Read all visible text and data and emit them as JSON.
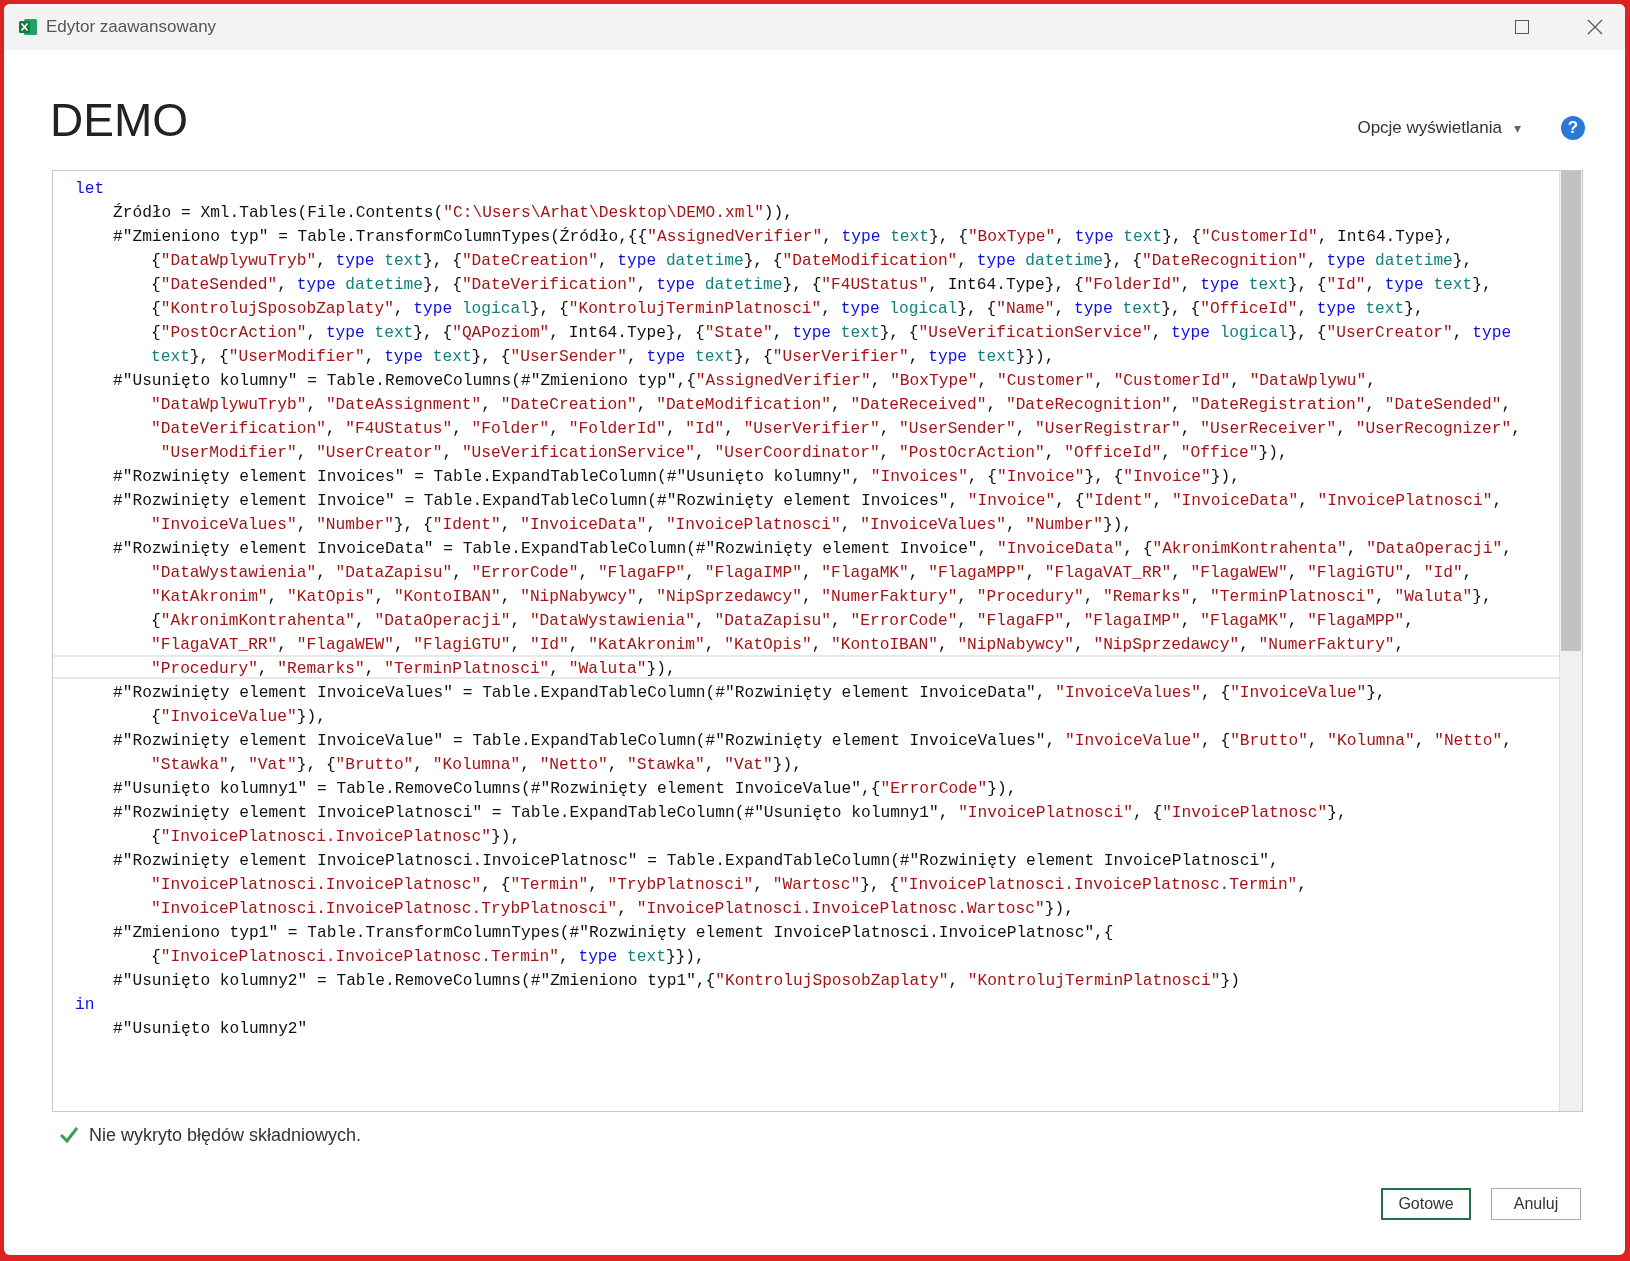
{
  "window": {
    "title": "Edytor zaawansowany"
  },
  "query_name": "DEMO",
  "display_options": {
    "label": "Opcje wyświetlania",
    "caret": "▾"
  },
  "help": {
    "label": "?"
  },
  "editor": {
    "lines": [
      {
        "kind": "keyword",
        "text": "let",
        "current": false,
        "children": [
          {
            "kind": "code",
            "text": "Źródło = Xml.Tables(File.Contents(\"C:\\Users\\Arhat\\Desktop\\DEMO.xml\")),",
            "current": false
          },
          {
            "kind": "code",
            "text": "#\"Zmieniono typ\" = Table.TransformColumnTypes(Źródło,{{\"AssignedVerifier\", type text}, {\"BoxType\", type text}, {\"CustomerId\", Int64.Type},",
            "current": false,
            "children": [
              {
                "kind": "code",
                "text": "{\"DataWplywuTryb\", type text}, {\"DateCreation\", type datetime}, {\"DateModification\", type datetime}, {\"DateRecognition\", type datetime},",
                "current": false
              },
              {
                "kind": "code",
                "text": "{\"DateSended\", type datetime}, {\"DateVerification\", type datetime}, {\"F4UStatus\", Int64.Type}, {\"FolderId\", type text}, {\"Id\", type text},",
                "current": false
              },
              {
                "kind": "code",
                "text": "{\"KontrolujSposobZaplaty\", type logical}, {\"KontrolujTerminPlatnosci\", type logical}, {\"Name\", type text}, {\"OfficeId\", type text},",
                "current": false
              },
              {
                "kind": "code",
                "text": "{\"PostOcrAction\", type text}, {\"QAPoziom\", Int64.Type}, {\"State\", type text}, {\"UseVerificationService\", type logical}, {\"UserCreator\", type",
                "current": false
              },
              {
                "kind": "code",
                "text": "text}, {\"UserModifier\", type text}, {\"UserSender\", type text}, {\"UserVerifier\", type text}}),",
                "current": false
              }
            ]
          },
          {
            "kind": "code",
            "text": "#\"Usunięto kolumny\" = Table.RemoveColumns(#\"Zmieniono typ\",{\"AssignedVerifier\", \"BoxType\", \"Customer\", \"CustomerId\", \"DataWplywu\",",
            "current": false,
            "children": [
              {
                "kind": "code",
                "text": "\"DataWplywuTryb\", \"DateAssignment\", \"DateCreation\", \"DateModification\", \"DateReceived\", \"DateRecognition\", \"DateRegistration\", \"DateSended\",",
                "current": false
              },
              {
                "kind": "code",
                "text": "\"DateVerification\", \"F4UStatus\", \"Folder\", \"FolderId\", \"Id\", \"UserVerifier\", \"UserSender\", \"UserRegistrar\", \"UserReceiver\", \"UserRecognizer\",",
                "current": false
              },
              {
                "kind": "code",
                "text": " \"UserModifier\", \"UserCreator\", \"UseVerificationService\", \"UserCoordinator\", \"PostOcrAction\", \"OfficeId\", \"Office\"}),",
                "current": false
              }
            ]
          },
          {
            "kind": "code",
            "text": "#\"Rozwinięty element Invoices\" = Table.ExpandTableColumn(#\"Usunięto kolumny\", \"Invoices\", {\"Invoice\"}, {\"Invoice\"}),",
            "current": false
          },
          {
            "kind": "code",
            "text": "#\"Rozwinięty element Invoice\" = Table.ExpandTableColumn(#\"Rozwinięty element Invoices\", \"Invoice\", {\"Ident\", \"InvoiceData\", \"InvoicePlatnosci\",",
            "current": false,
            "children": [
              {
                "kind": "code",
                "text": "\"InvoiceValues\", \"Number\"}, {\"Ident\", \"InvoiceData\", \"InvoicePlatnosci\", \"InvoiceValues\", \"Number\"}),",
                "current": false
              }
            ]
          },
          {
            "kind": "code",
            "text": "#\"Rozwinięty element InvoiceData\" = Table.ExpandTableColumn(#\"Rozwinięty element Invoice\", \"InvoiceData\", {\"AkronimKontrahenta\", \"DataOperacji\",",
            "current": false,
            "children": [
              {
                "kind": "code",
                "text": "\"DataWystawienia\", \"DataZapisu\", \"ErrorCode\", \"FlagaFP\", \"FlagaIMP\", \"FlagaMK\", \"FlagaMPP\", \"FlagaVAT_RR\", \"FlagaWEW\", \"FlagiGTU\", \"Id\",",
                "current": false
              },
              {
                "kind": "code",
                "text": "\"KatAkronim\", \"KatOpis\", \"KontoIBAN\", \"NipNabywcy\", \"NipSprzedawcy\", \"NumerFaktury\", \"Procedury\", \"Remarks\", \"TerminPlatnosci\", \"Waluta\"},",
                "current": false
              },
              {
                "kind": "code",
                "text": "{\"AkronimKontrahenta\", \"DataOperacji\", \"DataWystawienia\", \"DataZapisu\", \"ErrorCode\", \"FlagaFP\", \"FlagaIMP\", \"FlagaMK\", \"FlagaMPP\",",
                "current": false
              },
              {
                "kind": "code",
                "text": "\"FlagaVAT_RR\", \"FlagaWEW\", \"FlagiGTU\", \"Id\", \"KatAkronim\", \"KatOpis\", \"KontoIBAN\", \"NipNabywcy\", \"NipSprzedawcy\", \"NumerFaktury\",",
                "current": false
              },
              {
                "kind": "code",
                "text": "\"Procedury\", \"Remarks\", \"TerminPlatnosci\", \"Waluta\"}),",
                "current": true
              }
            ]
          },
          {
            "kind": "code",
            "text": "#\"Rozwinięty element InvoiceValues\" = Table.ExpandTableColumn(#\"Rozwinięty element InvoiceData\", \"InvoiceValues\", {\"InvoiceValue\"},",
            "current": false,
            "children": [
              {
                "kind": "code",
                "text": "{\"InvoiceValue\"}),",
                "current": false
              }
            ]
          },
          {
            "kind": "code",
            "text": "#\"Rozwinięty element InvoiceValue\" = Table.ExpandTableColumn(#\"Rozwinięty element InvoiceValues\", \"InvoiceValue\", {\"Brutto\", \"Kolumna\", \"Netto\",",
            "current": false,
            "children": [
              {
                "kind": "code",
                "text": "\"Stawka\", \"Vat\"}, {\"Brutto\", \"Kolumna\", \"Netto\", \"Stawka\", \"Vat\"}),",
                "current": false
              }
            ]
          },
          {
            "kind": "code",
            "text": "#\"Usunięto kolumny1\" = Table.RemoveColumns(#\"Rozwinięty element InvoiceValue\",{\"ErrorCode\"}),",
            "current": false
          },
          {
            "kind": "code",
            "text": "#\"Rozwinięty element InvoicePlatnosci\" = Table.ExpandTableColumn(#\"Usunięto kolumny1\", \"InvoicePlatnosci\", {\"InvoicePlatnosc\"},",
            "current": false,
            "children": [
              {
                "kind": "code",
                "text": "{\"InvoicePlatnosci.InvoicePlatnosc\"}),",
                "current": false
              }
            ]
          },
          {
            "kind": "code",
            "text": "#\"Rozwinięty element InvoicePlatnosci.InvoicePlatnosc\" = Table.ExpandTableColumn(#\"Rozwinięty element InvoicePlatnosci\",",
            "current": false,
            "children": [
              {
                "kind": "code",
                "text": "\"InvoicePlatnosci.InvoicePlatnosc\", {\"Termin\", \"TrybPlatnosci\", \"Wartosc\"}, {\"InvoicePlatnosci.InvoicePlatnosc.Termin\",",
                "current": false
              },
              {
                "kind": "code",
                "text": "\"InvoicePlatnosci.InvoicePlatnosc.TrybPlatnosci\", \"InvoicePlatnosci.InvoicePlatnosc.Wartosc\"}),",
                "current": false
              }
            ]
          },
          {
            "kind": "code",
            "text": "#\"Zmieniono typ1\" = Table.TransformColumnTypes(#\"Rozwinięty element InvoicePlatnosci.InvoicePlatnosc\",{",
            "current": false,
            "children": [
              {
                "kind": "code",
                "text": "{\"InvoicePlatnosci.InvoicePlatnosc.Termin\", type text}}),",
                "current": false
              }
            ]
          },
          {
            "kind": "code",
            "text": "#\"Usunięto kolumny2\" = Table.RemoveColumns(#\"Zmieniono typ1\",{\"KontrolujSposobZaplaty\", \"KontrolujTerminPlatnosci\"})",
            "current": false
          }
        ]
      },
      {
        "kind": "keyword",
        "text": "in",
        "current": false,
        "children": [
          {
            "kind": "code",
            "text": "#\"Usunięto kolumny2\"",
            "current": false
          }
        ]
      }
    ]
  },
  "status": {
    "text": "Nie wykryto błędów składniowych.",
    "ok": true
  },
  "buttons": [
    {
      "label": "Gotowe",
      "primary": true
    },
    {
      "label": "Anuluj",
      "primary": false
    }
  ]
}
